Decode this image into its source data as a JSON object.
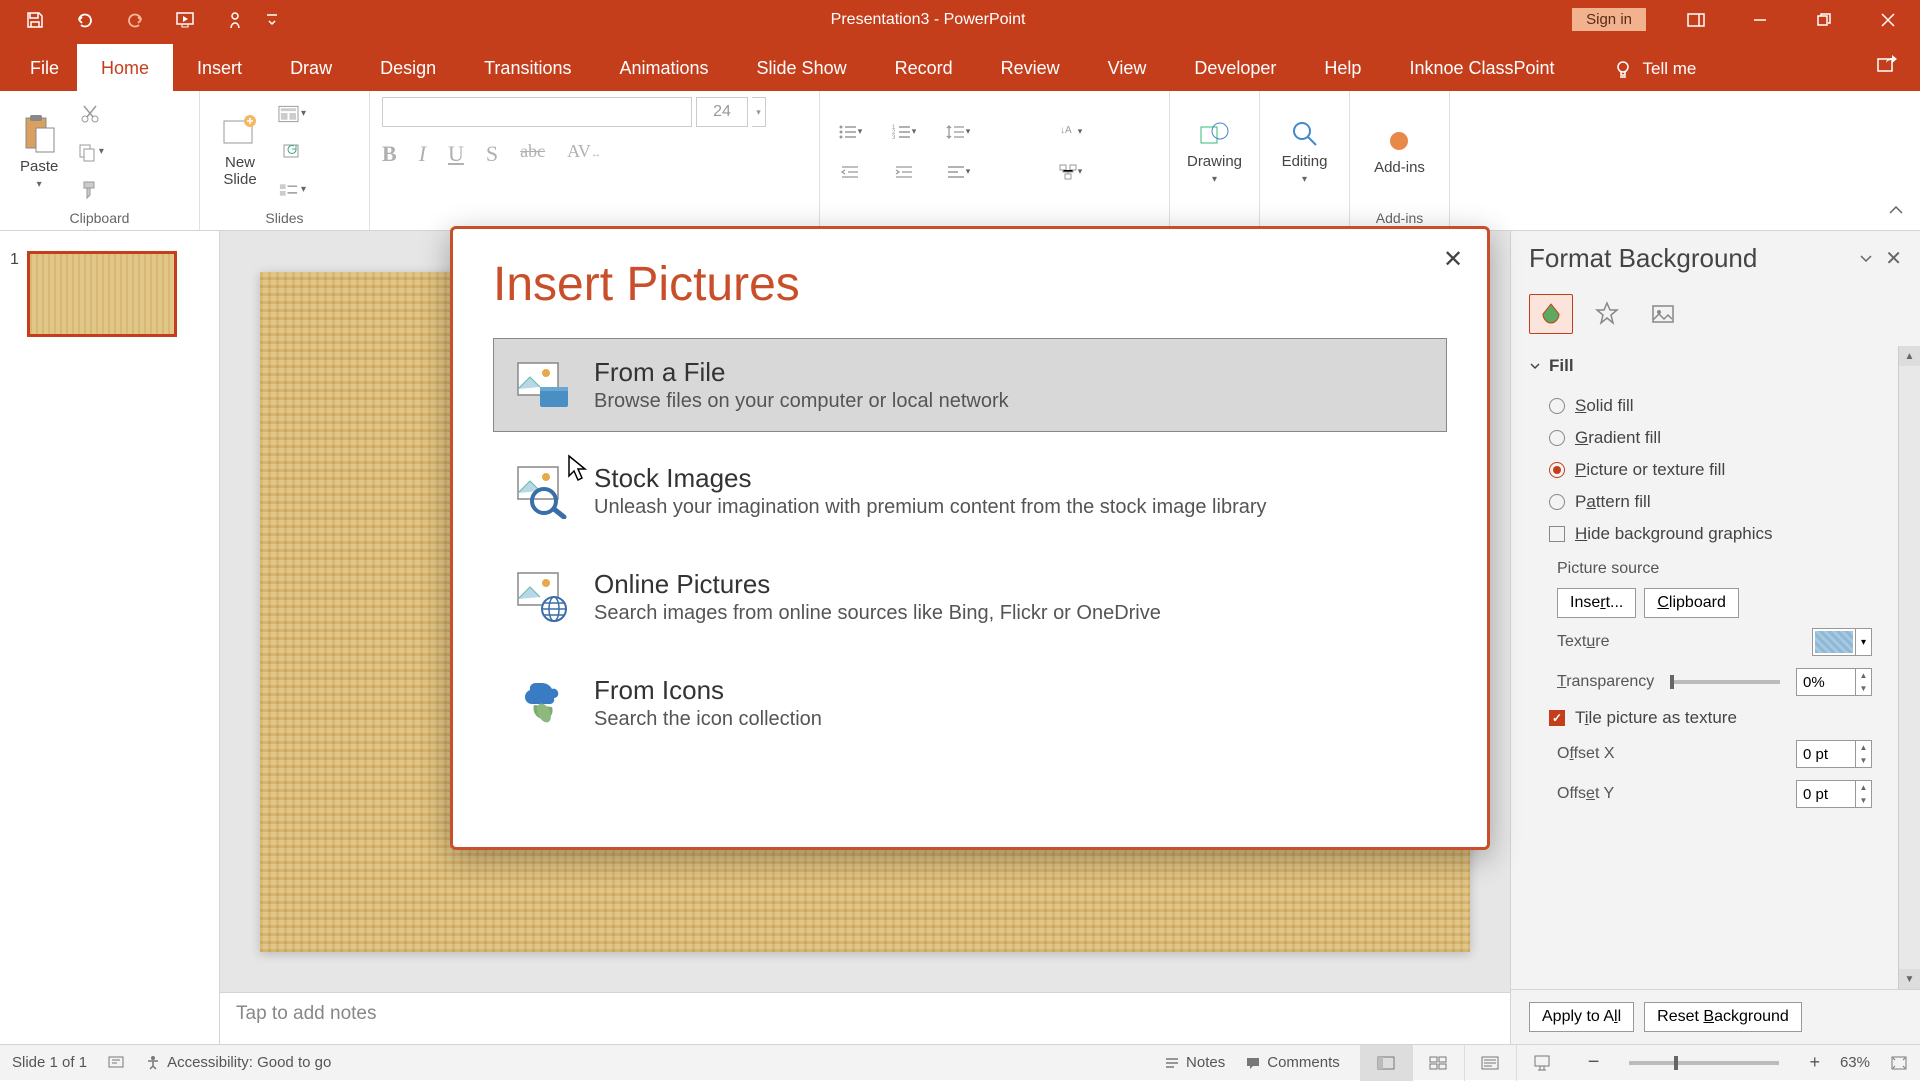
{
  "title_bar": {
    "document_title": "Presentation3 - PowerPoint",
    "sign_in": "Sign in"
  },
  "tabs": {
    "file": "File",
    "home": "Home",
    "insert": "Insert",
    "draw": "Draw",
    "design": "Design",
    "transitions": "Transitions",
    "animations": "Animations",
    "slide_show": "Slide Show",
    "record": "Record",
    "review": "Review",
    "view": "View",
    "developer": "Developer",
    "help": "Help",
    "classpoint": "Inknoe ClassPoint",
    "tell_me": "Tell me"
  },
  "ribbon": {
    "clipboard": {
      "label": "Clipboard",
      "paste": "Paste"
    },
    "slides": {
      "label": "Slides",
      "new_slide": "New\nSlide"
    },
    "font": {
      "size": "24"
    },
    "drawing": {
      "label": "Drawing"
    },
    "editing": {
      "label": "Editing"
    },
    "addins": {
      "label": "Add-ins",
      "btn": "Add-ins"
    }
  },
  "thumbnails": {
    "slide1_num": "1"
  },
  "notes_placeholder": "Tap to add notes",
  "task_pane": {
    "title": "Format Background",
    "fill_header": "Fill",
    "solid_fill": "Solid fill",
    "gradient_fill": "Gradient fill",
    "picture_fill": "Picture or texture fill",
    "pattern_fill": "Pattern fill",
    "hide_bg": "Hide background graphics",
    "picture_source": "Picture source",
    "insert_btn": "Insert...",
    "clipboard_btn": "Clipboard",
    "texture": "Texture",
    "transparency": "Transparency",
    "transparency_val": "0%",
    "tile": "Tile picture as texture",
    "offset_x": "Offset X",
    "offset_x_val": "0 pt",
    "offset_y": "Offset Y",
    "offset_y_val": "0 pt",
    "apply_all": "Apply to All",
    "reset": "Reset Background"
  },
  "dialog": {
    "title": "Insert Pictures",
    "options": [
      {
        "title": "From a File",
        "desc": "Browse files on your computer or local network"
      },
      {
        "title": "Stock Images",
        "desc": "Unleash your imagination with premium content from the stock image library"
      },
      {
        "title": "Online Pictures",
        "desc": "Search images from online sources like Bing, Flickr or OneDrive"
      },
      {
        "title": "From Icons",
        "desc": "Search the icon collection"
      }
    ]
  },
  "status_bar": {
    "slide_info": "Slide 1 of 1",
    "accessibility": "Accessibility: Good to go",
    "notes": "Notes",
    "comments": "Comments",
    "zoom": "63%"
  }
}
